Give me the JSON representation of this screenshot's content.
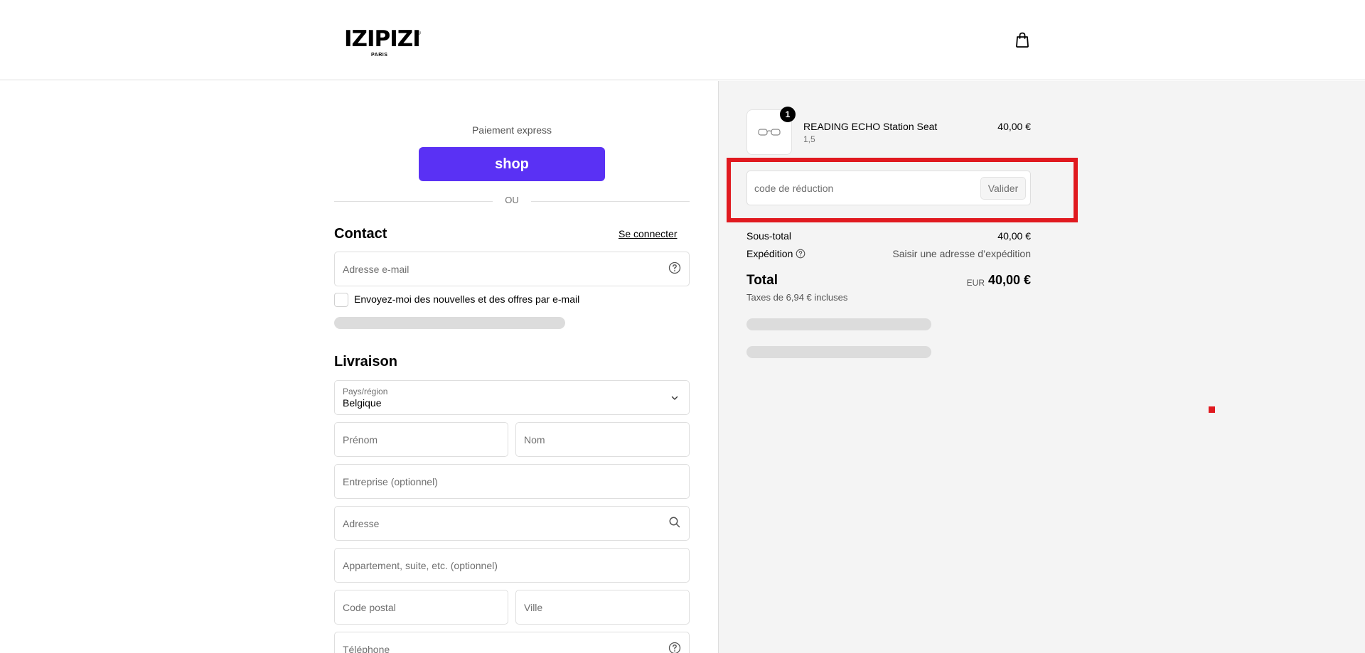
{
  "header": {
    "brand": "IZIPIZI",
    "brand_mark": "®",
    "brand_sub": "PARIS",
    "cart_icon": "shopping-bag-icon"
  },
  "express": {
    "label": "Paiement express",
    "shop_pay_label": "shop",
    "separator": "OU"
  },
  "contact": {
    "title": "Contact",
    "login_link": "Se connecter",
    "email_placeholder": "Adresse e-mail",
    "newsletter_label": "Envoyez-moi des nouvelles et des offres par e-mail"
  },
  "delivery": {
    "title": "Livraison",
    "country_label": "Pays/région",
    "country_value": "Belgique",
    "first_name_placeholder": "Prénom",
    "last_name_placeholder": "Nom",
    "company_placeholder": "Entreprise (optionnel)",
    "address_placeholder": "Adresse",
    "apartment_placeholder": "Appartement, suite, etc. (optionnel)",
    "postal_code_placeholder": "Code postal",
    "city_placeholder": "Ville",
    "phone_placeholder": "Téléphone"
  },
  "order": {
    "product": {
      "name": "READING ECHO Station Seat",
      "variant": "1,5",
      "price": "40,00 €",
      "quantity": "1"
    },
    "discount": {
      "placeholder": "code de réduction",
      "apply_label": "Valider"
    },
    "subtotal_label": "Sous-total",
    "subtotal_value": "40,00 €",
    "shipping_label": "Expédition",
    "shipping_value": "Saisir une adresse d’expédition",
    "total_label": "Total",
    "total_currency": "EUR",
    "total_value": "40,00 €",
    "tax_note": "Taxes de 6,94 € incluses"
  },
  "colors": {
    "shop_pay": "#5a31f4",
    "highlight": "#e0191f",
    "summary_bg": "#f4f4f4"
  }
}
